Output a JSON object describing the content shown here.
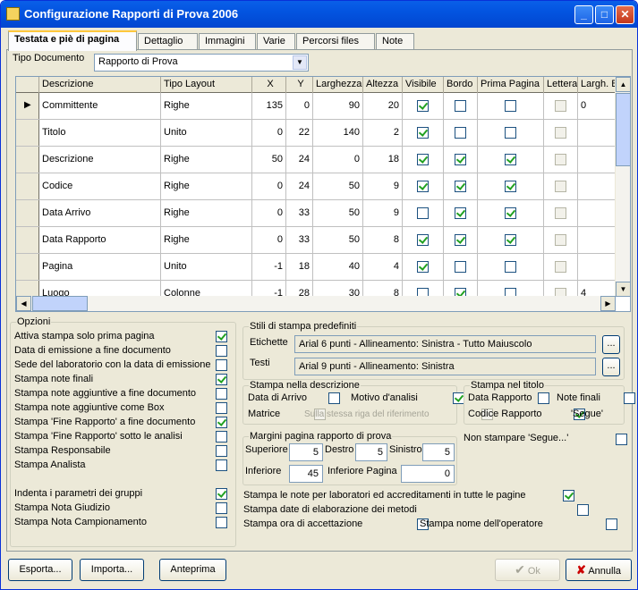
{
  "window": {
    "title": "Configurazione Rapporti di Prova 2006",
    "min": "_",
    "max": "□",
    "close": "✕"
  },
  "tabs": [
    "Testata e piè di pagina",
    "Dettaglio",
    "Immagini",
    "Varie",
    "Percorsi files",
    "Note"
  ],
  "tipo": {
    "label": "Tipo Documento",
    "value": "Rapporto di Prova"
  },
  "grid": {
    "columns": [
      "Descrizione",
      "Tipo Layout",
      "X",
      "Y",
      "Larghezza",
      "Altezza",
      "Visibile",
      "Bordo",
      "Prima Pagina",
      "Lettera",
      "Largh. B"
    ],
    "rows": [
      {
        "d": "Committente",
        "t": "Righe",
        "x": "135",
        "y": "0",
        "w": "90",
        "h": "20",
        "v": true,
        "b": false,
        "p": false,
        "l": false,
        "lb": "0"
      },
      {
        "d": "Titolo",
        "t": "Unito",
        "x": "0",
        "y": "22",
        "w": "140",
        "h": "2",
        "v": true,
        "b": false,
        "p": false,
        "l": false,
        "lb": ""
      },
      {
        "d": "Descrizione",
        "t": "Righe",
        "x": "50",
        "y": "24",
        "w": "0",
        "h": "18",
        "v": true,
        "b": true,
        "p": true,
        "l": false,
        "lb": ""
      },
      {
        "d": "Codice",
        "t": "Righe",
        "x": "0",
        "y": "24",
        "w": "50",
        "h": "9",
        "v": true,
        "b": true,
        "p": true,
        "l": false,
        "lb": ""
      },
      {
        "d": "Data Arrivo",
        "t": "Righe",
        "x": "0",
        "y": "33",
        "w": "50",
        "h": "9",
        "v": false,
        "b": true,
        "p": true,
        "l": false,
        "lb": ""
      },
      {
        "d": "Data Rapporto",
        "t": "Righe",
        "x": "0",
        "y": "33",
        "w": "50",
        "h": "8",
        "v": true,
        "b": true,
        "p": true,
        "l": false,
        "lb": ""
      },
      {
        "d": "Pagina",
        "t": "Unito",
        "x": "-1",
        "y": "18",
        "w": "40",
        "h": "4",
        "v": true,
        "b": false,
        "p": false,
        "l": false,
        "lb": ""
      },
      {
        "d": "Luogo",
        "t": "Colonne",
        "x": "-1",
        "y": "28",
        "w": "30",
        "h": "8",
        "v": false,
        "b": true,
        "p": false,
        "l": false,
        "lb": "4"
      }
    ]
  },
  "opzioni": {
    "title": "Opzioni",
    "items": [
      {
        "label": "Attiva stampa solo prima pagina",
        "on": true
      },
      {
        "label": "Data di emissione a fine documento",
        "on": false
      },
      {
        "label": "Sede del laboratorio con la data di emissione",
        "on": false
      },
      {
        "label": "Stampa note finali",
        "on": true
      },
      {
        "label": "Stampa note aggiuntive a fine documento",
        "on": false
      },
      {
        "label": "Stampa note aggiuntive come Box",
        "on": false
      },
      {
        "label": "Stampa 'Fine Rapporto' a fine documento",
        "on": true
      },
      {
        "label": "Stampa 'Fine Rapporto' sotto le analisi",
        "on": false
      },
      {
        "label": "Stampa Responsabile",
        "on": false
      },
      {
        "label": "Stampa Analista",
        "on": false
      },
      {
        "label": "Indenta i parametri dei gruppi",
        "on": true
      },
      {
        "label": "Stampa Nota Giudizio",
        "on": false
      },
      {
        "label": "Stampa Nota Campionamento",
        "on": false
      }
    ]
  },
  "stili": {
    "title": "Stili di stampa predefiniti",
    "etichette_label": "Etichette",
    "etichette_value": "Arial 6 punti - Allineamento: Sinistra - Tutto Maiuscolo",
    "testi_label": "Testi",
    "testi_value": "Arial 9 punti - Allineamento: Sinistra",
    "browse": "..."
  },
  "descr": {
    "title": "Stampa nella descrizione",
    "data_arrivo": "Data di Arrivo",
    "motivo": "Motivo d'analisi",
    "matrice": "Matrice",
    "stessa_riga": "Sulla stessa riga del riferimento"
  },
  "titolo": {
    "title": "Stampa nel titolo",
    "data_rapporto": "Data Rapporto",
    "note_finali": "Note finali",
    "codice_rapporto": "Codice Rapporto",
    "segue": "'Segue'"
  },
  "non_stampare": "Non stampare 'Segue...'",
  "margini": {
    "title": "Margini pagina rapporto di prova",
    "superiore_label": "Superiore",
    "superiore": "5",
    "destro_label": "Destro",
    "destro": "5",
    "sinistro_label": "Sinistro",
    "sinistro": "5",
    "inferiore_label": "Inferiore",
    "inferiore": "45",
    "inferiore_pagina_label": "Inferiore Pagina",
    "inferiore_pagina": "0"
  },
  "extra": {
    "note_lab": "Stampa le note per laboratori ed accreditamenti in tutte le pagine",
    "date_elab": "Stampa date di elaborazione dei metodi",
    "ora_acc": "Stampa ora di accettazione",
    "nome_op": "Stampa nome dell'operatore"
  },
  "buttons": {
    "esporta": "Esporta...",
    "importa": "Importa...",
    "anteprima": "Anteprima",
    "ok": "Ok",
    "annulla": "Annulla"
  }
}
